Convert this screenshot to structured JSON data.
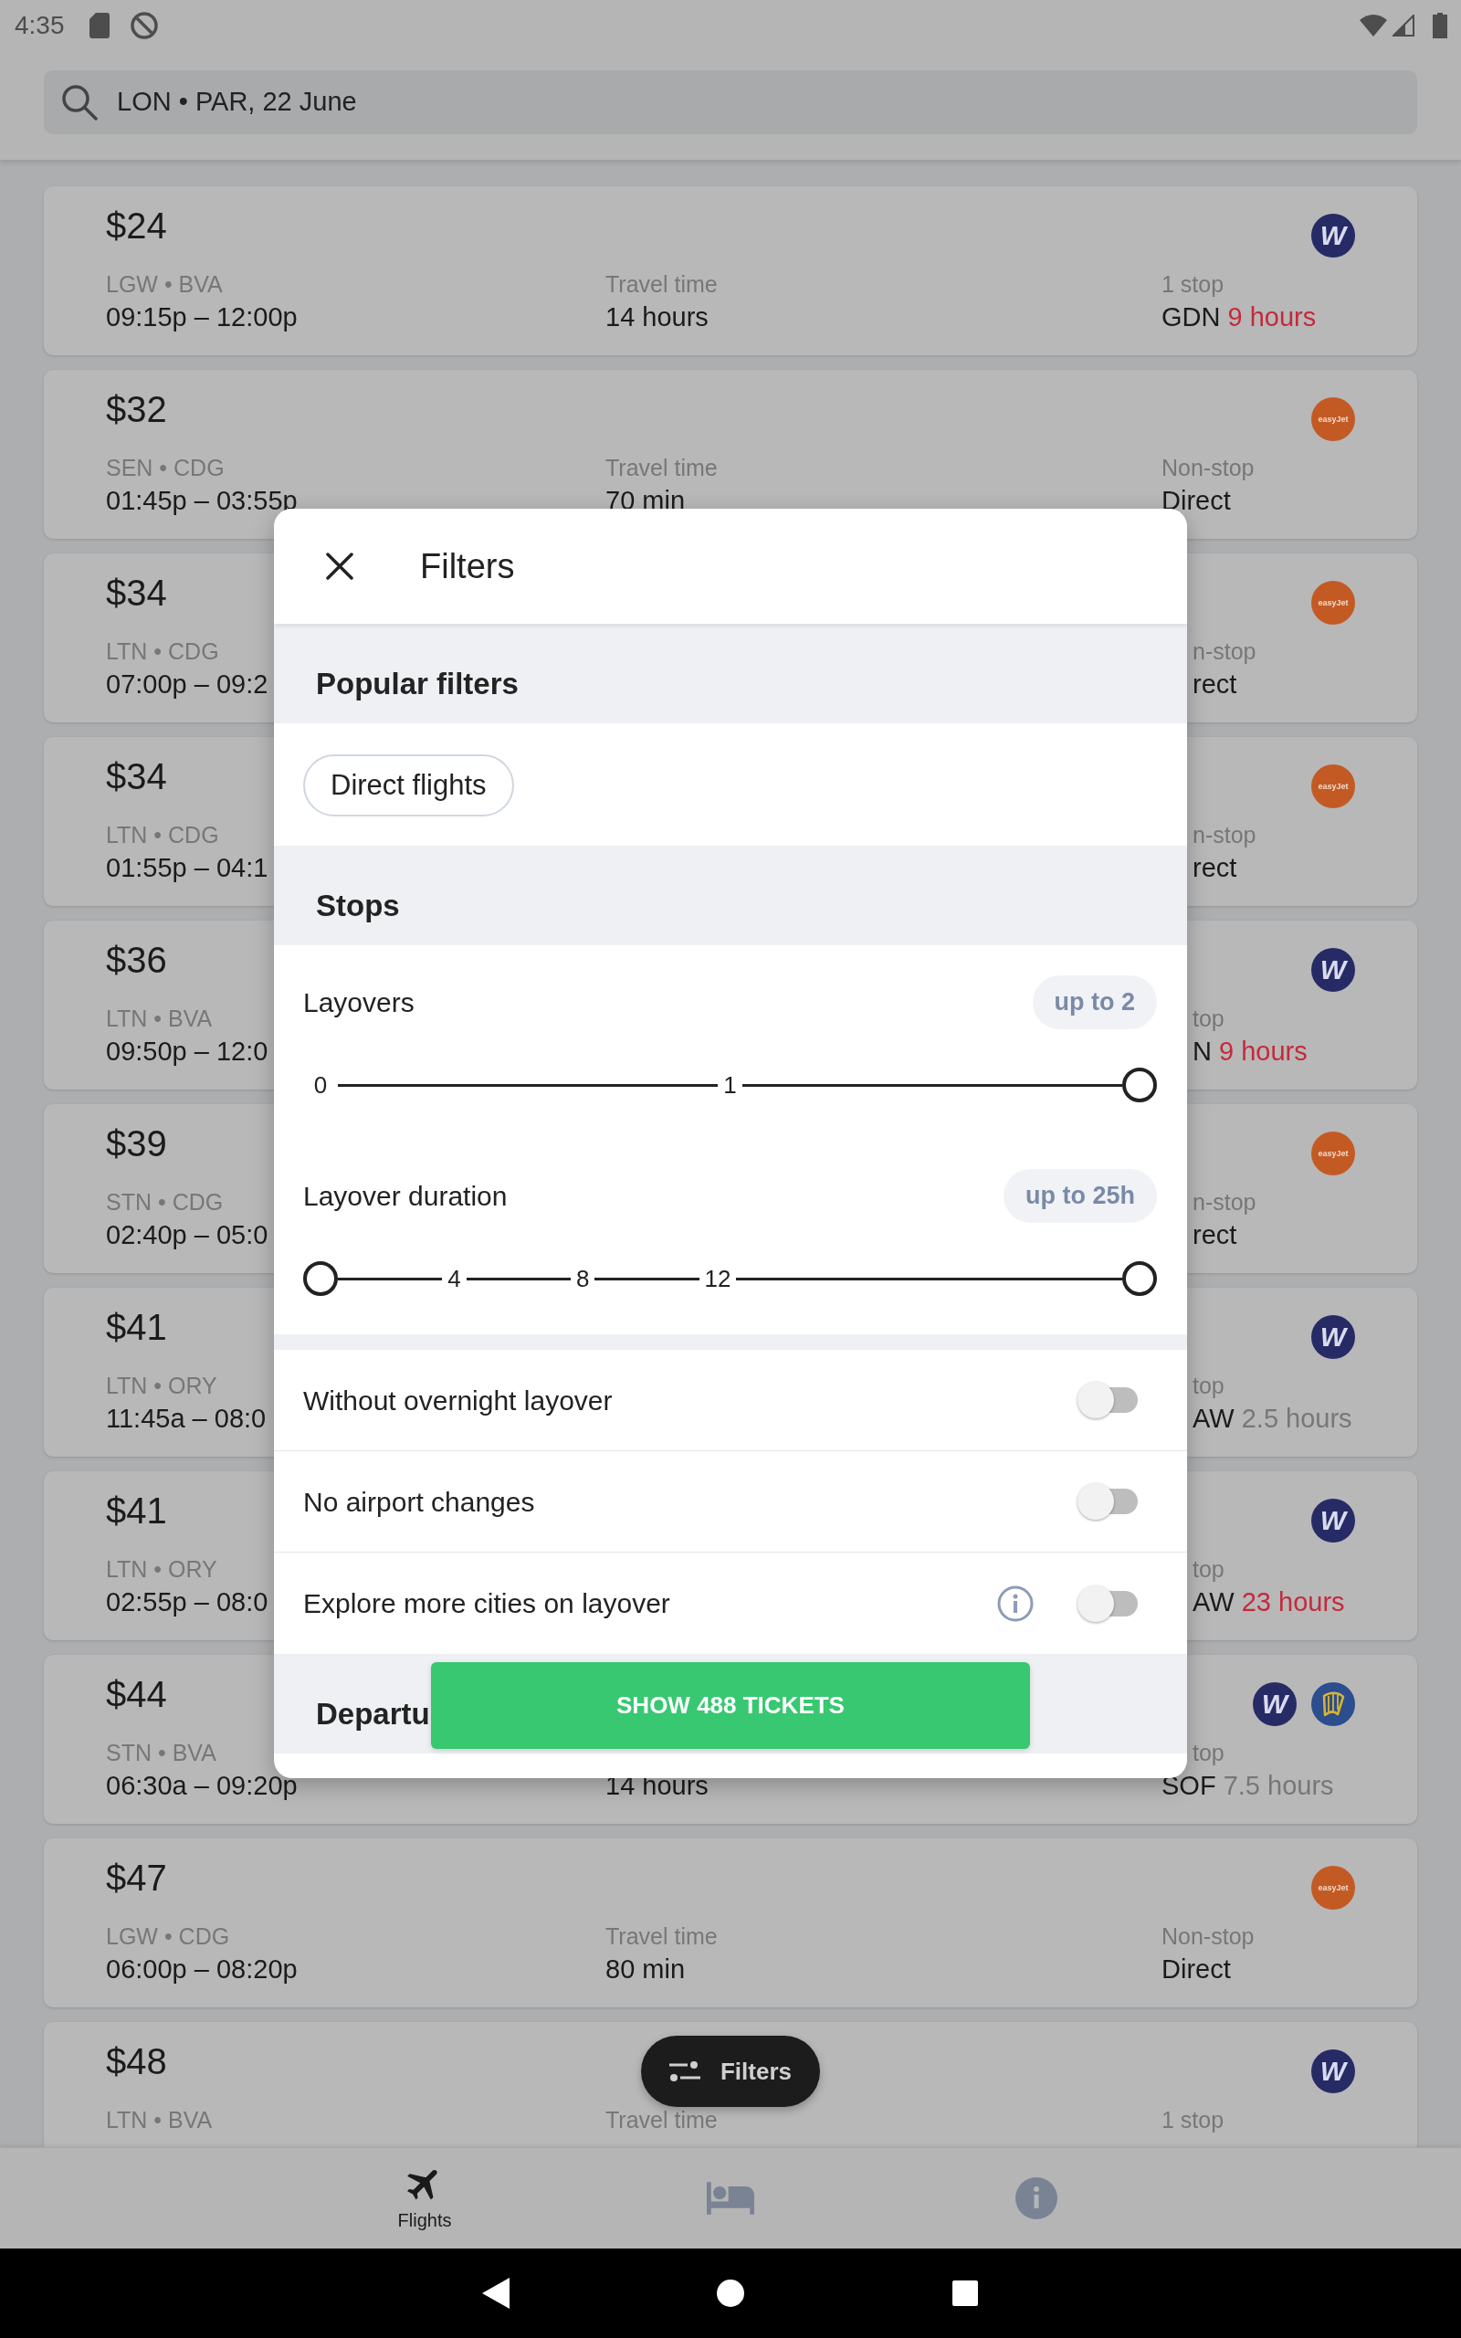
{
  "status_bar": {
    "time": "4:35"
  },
  "search": {
    "value": "LON • PAR, 22 June"
  },
  "flights": [
    {
      "kind": "open",
      "price": "$24",
      "route": "LGW • BVA",
      "times": "09:15p – 12:00p",
      "duration_label": "Travel time",
      "duration": "14 hours",
      "stops": "1 stop",
      "stop_place": "GDN",
      "layover": "9 hours",
      "long_layover": true,
      "logos": [
        {
          "kind": "letter",
          "text": "W",
          "color": "#262b66"
        }
      ]
    },
    {
      "kind": "open",
      "price": "$32",
      "route": "SEN • CDG",
      "times": "01:45p – 03:55p",
      "duration_label": "Travel time",
      "duration": "70 min",
      "stops": "Non-stop",
      "stop_place": "Direct",
      "logos": [
        {
          "kind": "wordmark",
          "text": "easyJet",
          "color": "#c35a24"
        }
      ]
    },
    {
      "kind": "covered",
      "price": "$34",
      "route": "LTN • CDG",
      "times": "07:00p – 09:2",
      "stops": "n-stop",
      "stop_place": "rect",
      "logos": [
        {
          "kind": "wordmark",
          "text": "easyJet",
          "color": "#c35a24"
        }
      ]
    },
    {
      "kind": "covered",
      "price": "$34",
      "route": "LTN • CDG",
      "times": "01:55p – 04:1",
      "stops": "n-stop",
      "stop_place": "rect",
      "logos": [
        {
          "kind": "wordmark",
          "text": "easyJet",
          "color": "#c35a24"
        }
      ]
    },
    {
      "kind": "covered",
      "price": "$36",
      "route": "LTN • BVA",
      "times": "09:50p – 12:0",
      "stops": "top",
      "stop_place": "N",
      "layover": "9 hours",
      "long_layover": true,
      "logos": [
        {
          "kind": "letter",
          "text": "W",
          "color": "#262b66"
        }
      ]
    },
    {
      "kind": "covered",
      "price": "$39",
      "route": "STN • CDG",
      "times": "02:40p – 05:0",
      "stops": "n-stop",
      "stop_place": "rect",
      "logos": [
        {
          "kind": "wordmark",
          "text": "easyJet",
          "color": "#c35a24"
        }
      ]
    },
    {
      "kind": "covered",
      "price": "$41",
      "route": "LTN • ORY",
      "times": "11:45a – 08:0",
      "stops": "top",
      "stop_place": "AW",
      "layover": "2.5 hours",
      "long_layover": false,
      "logos": [
        {
          "kind": "letter",
          "text": "W",
          "color": "#262b66"
        }
      ]
    },
    {
      "kind": "covered",
      "price": "$41",
      "route": "LTN • ORY",
      "times": "02:55p – 08:0",
      "stops": "top",
      "stop_place": "AW",
      "layover": "23 hours",
      "long_layover": true,
      "logos": [
        {
          "kind": "letter",
          "text": "W",
          "color": "#262b66"
        }
      ]
    },
    {
      "kind": "covered-top",
      "price": "$44",
      "route": "STN • BVA",
      "times": "06:30a – 09:20p",
      "duration": "14 hours",
      "stops": "top",
      "stop_place": "SOF",
      "layover": "7.5 hours",
      "long_layover": false,
      "logos": [
        {
          "kind": "letter",
          "text": "W",
          "color": "#262b66"
        },
        {
          "kind": "harp",
          "color": "#2c4d8e"
        }
      ]
    },
    {
      "kind": "open",
      "price": "$47",
      "route": "LGW • CDG",
      "times": "06:00p – 08:20p",
      "duration_label": "Travel time",
      "duration": "80 min",
      "stops": "Non-stop",
      "stop_place": "Direct",
      "logos": [
        {
          "kind": "wordmark",
          "text": "easyJet",
          "color": "#c35a24"
        }
      ]
    },
    {
      "kind": "open",
      "price": "$48",
      "route": "LTN • BVA",
      "duration_label": "Travel time",
      "stops": "1 stop",
      "logos": [
        {
          "kind": "letter",
          "text": "W",
          "color": "#262b66"
        }
      ]
    }
  ],
  "filters_fab": {
    "label": "Filters"
  },
  "bottom_nav": [
    {
      "kind": "plane",
      "label": "Flights",
      "selected": true
    },
    {
      "kind": "bed",
      "selected": false
    },
    {
      "kind": "info",
      "selected": false
    }
  ],
  "filters_dialog": {
    "title": "Filters",
    "sections": [
      {
        "kind": "chips",
        "title": "Popular filters",
        "chips": [
          {
            "label": "Direct flights",
            "selected": false
          }
        ]
      },
      {
        "kind": "sliders",
        "title": "Stops",
        "sliders": [
          {
            "kind": "single",
            "label": "Layovers",
            "badge": "up to 2",
            "ticks": [
              {
                "kind": "start",
                "label": "0"
              },
              {
                "kind": "mark",
                "label": "1"
              }
            ],
            "thumbs": [
              {
                "level": 1
              }
            ]
          },
          {
            "kind": "range",
            "label": "Layover duration",
            "badge": "up to 25h",
            "ticks": [
              {
                "kind": "mark",
                "label": "4"
              },
              {
                "kind": "mark",
                "label": "8"
              },
              {
                "kind": "mark",
                "label": "12"
              }
            ],
            "thumbs": [
              {
                "level": 0
              },
              {
                "level": 1
              }
            ]
          }
        ]
      },
      {
        "kind": "toggles",
        "toggles": [
          {
            "label": "Without overnight layover",
            "info": false,
            "checked": false
          },
          {
            "label": "No airport changes",
            "info": false,
            "checked": false
          },
          {
            "label": "Explore more cities on layover",
            "info": true,
            "checked": false
          }
        ]
      },
      {
        "kind": "heading",
        "title": "Departu"
      }
    ],
    "button": "SHOW 488 TICKETS"
  }
}
